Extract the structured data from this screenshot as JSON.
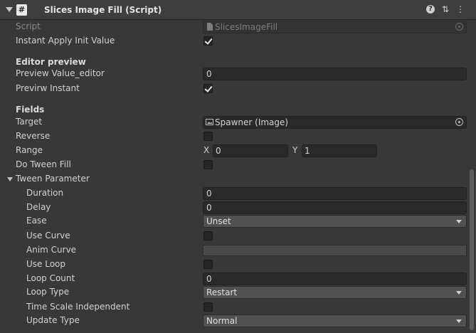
{
  "header": {
    "title": "Slices Image Fill (Script)",
    "script_icon_glyph": "#",
    "help_glyph": "?",
    "presets_glyph": "⇅",
    "menu_glyph": "⋮"
  },
  "script_row": {
    "label": "Script",
    "value": "SlicesImageFill"
  },
  "instant_apply": {
    "label": "Instant Apply Init Value",
    "checked": true
  },
  "editor_preview": {
    "heading": "Editor preview",
    "preview_value": {
      "label": "Preview Value_editor",
      "value": "0"
    },
    "previrw_instant": {
      "label": "Previrw Instant",
      "checked": true
    }
  },
  "fields": {
    "heading": "Fields",
    "target": {
      "label": "Target",
      "value": "Spawner (Image)"
    },
    "reverse": {
      "label": "Reverse",
      "checked": false
    },
    "range": {
      "label": "Range",
      "x_label": "X",
      "x_value": "0",
      "y_label": "Y",
      "y_value": "1"
    },
    "do_tween_fill": {
      "label": "Do Tween Fill",
      "checked": false
    }
  },
  "tween": {
    "label": "Tween Parameter",
    "duration": {
      "label": "Duration",
      "value": "0"
    },
    "delay": {
      "label": "Delay",
      "value": "0"
    },
    "ease": {
      "label": "Ease",
      "value": "Unset"
    },
    "use_curve": {
      "label": "Use Curve",
      "checked": false
    },
    "anim_curve": {
      "label": "Anim Curve"
    },
    "use_loop": {
      "label": "Use Loop",
      "checked": false
    },
    "loop_count": {
      "label": "Loop Count",
      "value": "0"
    },
    "loop_type": {
      "label": "Loop Type",
      "value": "Restart"
    },
    "time_scale_independent": {
      "label": "Time Scale Independent",
      "checked": false
    },
    "update_type": {
      "label": "Update Type",
      "value": "Normal"
    }
  },
  "colors": {
    "background": "#383838",
    "header": "#3e3e3e",
    "field": "#2a2a2a",
    "dropdown": "#515151",
    "text": "#d2d2d2"
  }
}
